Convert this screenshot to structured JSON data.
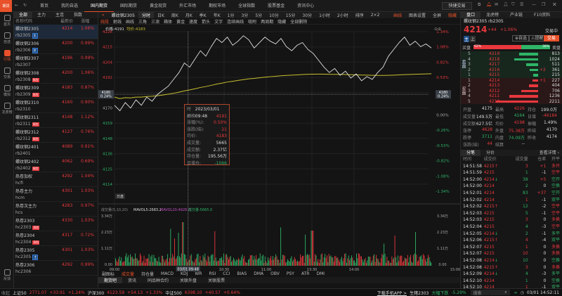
{
  "app": {
    "logo": "期货",
    "nav": [
      "首页",
      "我的自选",
      "国内期货",
      "国际期货",
      "黄金现货",
      "外汇市场",
      "期权市场",
      "全球指数",
      "股票基金",
      "资讯中心"
    ],
    "quick_trade": "快捷交易"
  },
  "sidebar": [
    "首页",
    "自选",
    "行情",
    "交易",
    "模拟",
    "龙虎榜",
    "反馈"
  ],
  "list": {
    "tabs": [
      "全部",
      "主力",
      "主连",
      "指数"
    ],
    "headers": [
      "名称代码",
      "最新价",
      "涨幅(%)"
    ],
    "rows": [
      {
        "name": "螺纹钢2305",
        "code": "rb2305",
        "tag": "主",
        "price": "4214",
        "pct": "1.06%"
      },
      {
        "name": "螺纹钢2306",
        "code": "rb2306",
        "tag": "次",
        "price": "4200",
        "pct": "0.99%"
      },
      {
        "name": "螺纹钢2307",
        "code": "rb2307",
        "tag": "",
        "price": "4196",
        "pct": "0.99%"
      },
      {
        "name": "螺纹钢2308",
        "code": "rb2308",
        "tag": "风险",
        "price": "4200",
        "pct": "1.06%"
      },
      {
        "name": "螺纹钢2309",
        "code": "rb2309",
        "tag": "风险",
        "price": "4183",
        "pct": "0.87%"
      },
      {
        "name": "螺纹钢2310",
        "code": "rb2310",
        "tag": "",
        "price": "4160",
        "pct": "0.90%"
      },
      {
        "name": "螺纹钢2311",
        "code": "rb2311",
        "tag": "风险",
        "price": "4148",
        "pct": "1.12%"
      },
      {
        "name": "螺纹钢2312",
        "code": "rb2312",
        "tag": "风险",
        "price": "4127",
        "pct": "0.76%"
      },
      {
        "name": "螺纹钢2401",
        "code": "rb2401",
        "tag": "",
        "price": "4089",
        "pct": "0.91%"
      },
      {
        "name": "螺纹钢2402",
        "code": "rb2402",
        "tag": "风险",
        "price": "4062",
        "pct": "0.69%"
      },
      {
        "name": "热卷加权",
        "code": "hcfi",
        "tag": "",
        "price": "4292",
        "pct": "1.04%"
      },
      {
        "name": "热卷主力",
        "code": "hcm",
        "tag": "",
        "price": "4301",
        "pct": "1.03%"
      },
      {
        "name": "热卷次主力",
        "code": "hcs",
        "tag": "",
        "price": "4283",
        "pct": "0.97%"
      },
      {
        "name": "热卷2303",
        "code": "hc2303",
        "tag": "风险",
        "price": "4330",
        "pct": "1.03%"
      },
      {
        "name": "热卷2304",
        "code": "hc2304",
        "tag": "风险",
        "price": "4317",
        "pct": "0.72%"
      },
      {
        "name": "热卷2305",
        "code": "hc2305",
        "tag": "主",
        "price": "4301",
        "pct": "1.03%"
      },
      {
        "name": "热卷2306",
        "code": "hc2306",
        "tag": "",
        "price": "4292",
        "pct": "0.99%"
      }
    ]
  },
  "toolbar": {
    "symbol": "螺纹钢2305",
    "period": "分时",
    "periods": [
      "日K",
      "周K",
      "月K",
      "季K",
      "年K",
      "1分",
      "3分",
      "5分",
      "10分",
      "15分",
      "30分",
      "1小时",
      "2小时"
    ],
    "sort": "排序",
    "layout": "2×2",
    "draw": "画线",
    "settings": "图表设置",
    "fullscreen": "全屏",
    "hide": "隐藏"
  },
  "drawbar": [
    "线段",
    "射线",
    "画线",
    "三角",
    "三浪",
    "箱体",
    "黄金",
    "速度",
    "箭头",
    "文字",
    "连续画线",
    "吸附",
    "两周期",
    "隐藏",
    "全部删除"
  ],
  "chart": {
    "price_label": "价格:4191",
    "avg_label": "均价:4183",
    "cursor_price": "4180",
    "cursor_pct": "0.24%",
    "day_tag": "日盘",
    "y_left": [
      "4226",
      "4215",
      "4204",
      "4192",
      "4180",
      "4170",
      "4159",
      "4148",
      "4136",
      "4125",
      "4114"
    ],
    "y_right": [
      "1.34%",
      "1.08%",
      "0.82%",
      "0.53%",
      "0.24%",
      "0.00%",
      "-0.26%",
      "-0.53%",
      "-0.82%",
      "-1.08%",
      "-1.34%"
    ],
    "x_labels": [
      "09:00",
      "10:30",
      "11:00",
      "13:30",
      "14:00",
      "15:00"
    ],
    "cursor_time": "03/01 09:48",
    "prices": [
      4172,
      4168,
      4174,
      4170,
      4176,
      4172,
      4178,
      4175,
      4180,
      4183,
      4186,
      4191,
      4196,
      4203,
      4200,
      4206,
      4212,
      4208,
      4215,
      4221,
      4218,
      4222,
      4216,
      4219,
      4223,
      4220,
      4214,
      4218,
      4222,
      4219,
      4217,
      4221,
      4215,
      4212,
      4216,
      4218,
      4213,
      4210,
      4205,
      4200,
      4196,
      4199,
      4194,
      4197,
      4192,
      4195,
      4190,
      4193,
      4191,
      4196,
      4200,
      4208,
      4213,
      4218,
      4222,
      4216,
      4219,
      4215,
      4217,
      4214
    ],
    "volume_title": "成交量(5,10,20)",
    "mavol5": "MAVOL5:2683.2",
    "mavol20": "MAVOL20:4928.3",
    "vol_now": "成交量:5665.0",
    "vol_axis": [
      "3.34万",
      "2.23万",
      "1.11万",
      "0.00"
    ]
  },
  "tooltip": [
    [
      "时间:",
      "2023/03/01 09:48"
    ],
    [
      "价格:",
      "4191"
    ],
    [
      "涨幅(%):",
      "0.50%"
    ],
    [
      "涨跌(结):",
      "21"
    ],
    [
      "均价:",
      "4183"
    ],
    [
      "成交量:",
      "5665"
    ],
    [
      "成交额:",
      "2.37亿"
    ],
    [
      "持仓量:",
      "195.56万"
    ],
    [
      "日增仓:",
      "-1066"
    ]
  ],
  "indicators": [
    "副图标",
    "成交量",
    "持仓量",
    "MACD",
    "KDJ",
    "WR",
    "RSI",
    "CCI",
    "BIAS",
    "DMA",
    "OBV",
    "PSY",
    "ATR",
    "DMI"
  ],
  "bottom_tabs": [
    "期货吧",
    "资讯",
    "同品种合约",
    "关联外盘",
    "关联股票"
  ],
  "right": {
    "tabs": [
      "盘口",
      "龙虎榜",
      "产业链",
      "F10资料"
    ],
    "title": "螺纹钢2305 rb2305",
    "price": "4214",
    "chg": "+44",
    "pct": "+1.06%",
    "state": "交易中",
    "btn_main": "主",
    "btn_up": "上",
    "fav": "自选",
    "alert": "提醒",
    "trade": "交易",
    "buy_label": "买盘",
    "sell_label": "卖盘",
    "buy_pct": "62%",
    "sell_pct": "38%",
    "buy_ratio": 62,
    "sell_side": "卖盘",
    "buy_side": "买盘",
    "asks": [
      [
        "5",
        "4219",
        "813",
        ""
      ],
      [
        "4",
        "4218",
        "1024",
        ""
      ],
      [
        "3",
        "4217",
        "511",
        ""
      ],
      [
        "2",
        "4216",
        "361",
        "+2"
      ],
      [
        "1",
        "4215",
        "215",
        ""
      ]
    ],
    "bids": [
      [
        "1",
        "4214",
        "227",
        "+1"
      ],
      [
        "2",
        "4213",
        "404",
        ""
      ],
      [
        "3",
        "4212",
        "706",
        ""
      ],
      [
        "4",
        "4211",
        "1236",
        ""
      ],
      [
        "5",
        "4210",
        "2211",
        ""
      ]
    ],
    "stats": [
      [
        "开盘",
        "4175"
      ],
      [
        "最高",
        "4226"
      ],
      [
        "持仓",
        "199.0万"
      ],
      [
        "成交量",
        "149.5万"
      ],
      [
        "最低",
        "4164"
      ],
      [
        "日增",
        "-46184"
      ],
      [
        "成交额",
        "627.5亿"
      ],
      [
        "均价",
        "4198"
      ],
      [
        "振幅",
        "1.49%"
      ],
      [
        "涨停",
        "4628"
      ],
      [
        "外盘",
        "75.38万"
      ],
      [
        "昨结",
        "4170"
      ],
      [
        "跌停",
        "3711"
      ],
      [
        "内盘",
        "74.09万"
      ],
      [
        "昨收",
        "4174"
      ],
      [
        "涨跌(结)",
        "44"
      ],
      [
        "结算",
        "--"
      ]
    ],
    "trade_tabs": [
      "分笔",
      "分价"
    ],
    "detail": "查看详情 ›",
    "trade_headers": [
      "时间",
      "成交价",
      "成交量",
      "仓差",
      "开平"
    ],
    "trades": [
      [
        "14:51:58",
        "4215",
        "↑",
        "3",
        "+1",
        "多开"
      ],
      [
        "14:51:59",
        "4215",
        "",
        "1",
        "-1",
        "空平"
      ],
      [
        "14:52:00",
        "4214",
        "↓",
        "38",
        "+5",
        "空开"
      ],
      [
        "14:52:00",
        "4214",
        "",
        "2",
        "0",
        "空换"
      ],
      [
        "14:52:01",
        "4214",
        "",
        "83",
        "+37",
        "空开"
      ],
      [
        "14:52:02",
        "4214",
        "",
        "1",
        "-1",
        "双平"
      ],
      [
        "14:52:02",
        "4215",
        "↑",
        "12",
        "-2",
        "空平"
      ],
      [
        "14:52:03",
        "4215",
        "",
        "5",
        "-1",
        "空平"
      ],
      [
        "14:52:03",
        "4215",
        "",
        "3",
        "0",
        "多换"
      ],
      [
        "14:52:04",
        "4215",
        "",
        "4",
        "-3",
        "空平"
      ],
      [
        "14:52:05",
        "4214",
        "↓",
        "2",
        "-1",
        "多平"
      ],
      [
        "14:52:06",
        "4215",
        "↑",
        "4",
        "-4",
        "双平"
      ],
      [
        "14:52:07",
        "4215",
        "",
        "1",
        "0",
        "多换"
      ],
      [
        "14:52:07",
        "4215",
        "",
        "10",
        "0",
        "多换"
      ],
      [
        "14:52:08",
        "4214",
        "↓",
        "10",
        "0",
        "空换"
      ],
      [
        "14:52:08",
        "4215",
        "↑",
        "3",
        "0",
        "多换"
      ],
      [
        "14:52:09",
        "4214",
        "↓",
        "4",
        "-3",
        "多平"
      ],
      [
        "14:52:10",
        "4214",
        "",
        "1",
        "0",
        "空换"
      ],
      [
        "14:52:10",
        "4214",
        "",
        "1",
        "-1",
        "双平"
      ]
    ]
  },
  "status": {
    "collapse": "收起",
    "indices": [
      [
        "上证50",
        "2771.07",
        "+33.91",
        "+1.24%"
      ],
      [
        "沪深300",
        "4123.59",
        "+54.13",
        "+1.33%"
      ],
      [
        "中证500",
        "6398.10",
        "+40.57",
        "+0.64%"
      ]
    ],
    "app_link": "下载手机APP >",
    "alert_sym": "生猪2303",
    "alert_text": "大幅下跌",
    "alert_pct": "-5.29%",
    "search": "搜索",
    "clock": "03/01 14:52:11"
  },
  "colors": {
    "up": "#e8383d",
    "down": "#2fb468",
    "accent": "#e8512a",
    "avg": "#c8c030"
  }
}
